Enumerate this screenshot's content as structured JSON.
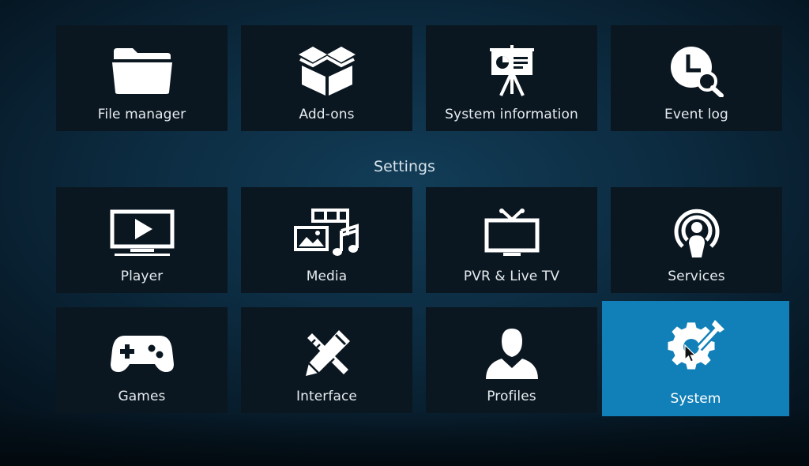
{
  "colors": {
    "tile_bg": "#0a1720",
    "focus_bg": "#1280b8",
    "icon": "#ffffff",
    "text": "#e6ebef"
  },
  "top_row": [
    {
      "label": "File manager",
      "icon": "folder-icon"
    },
    {
      "label": "Add-ons",
      "icon": "open-box-icon"
    },
    {
      "label": "System information",
      "icon": "presentation-board-icon"
    },
    {
      "label": "Event log",
      "icon": "clock-search-icon"
    }
  ],
  "section_title": "Settings",
  "settings": [
    {
      "label": "Player",
      "icon": "play-screen-icon"
    },
    {
      "label": "Media",
      "icon": "media-library-icon"
    },
    {
      "label": "PVR & Live TV",
      "icon": "tv-antenna-icon"
    },
    {
      "label": "Services",
      "icon": "broadcast-user-icon"
    },
    {
      "label": "Games",
      "icon": "gamepad-icon"
    },
    {
      "label": "Interface",
      "icon": "pencil-ruler-icon"
    },
    {
      "label": "Profiles",
      "icon": "user-silhouette-icon"
    },
    {
      "label": "System",
      "icon": "gear-wrench-icon",
      "focused": true
    }
  ]
}
